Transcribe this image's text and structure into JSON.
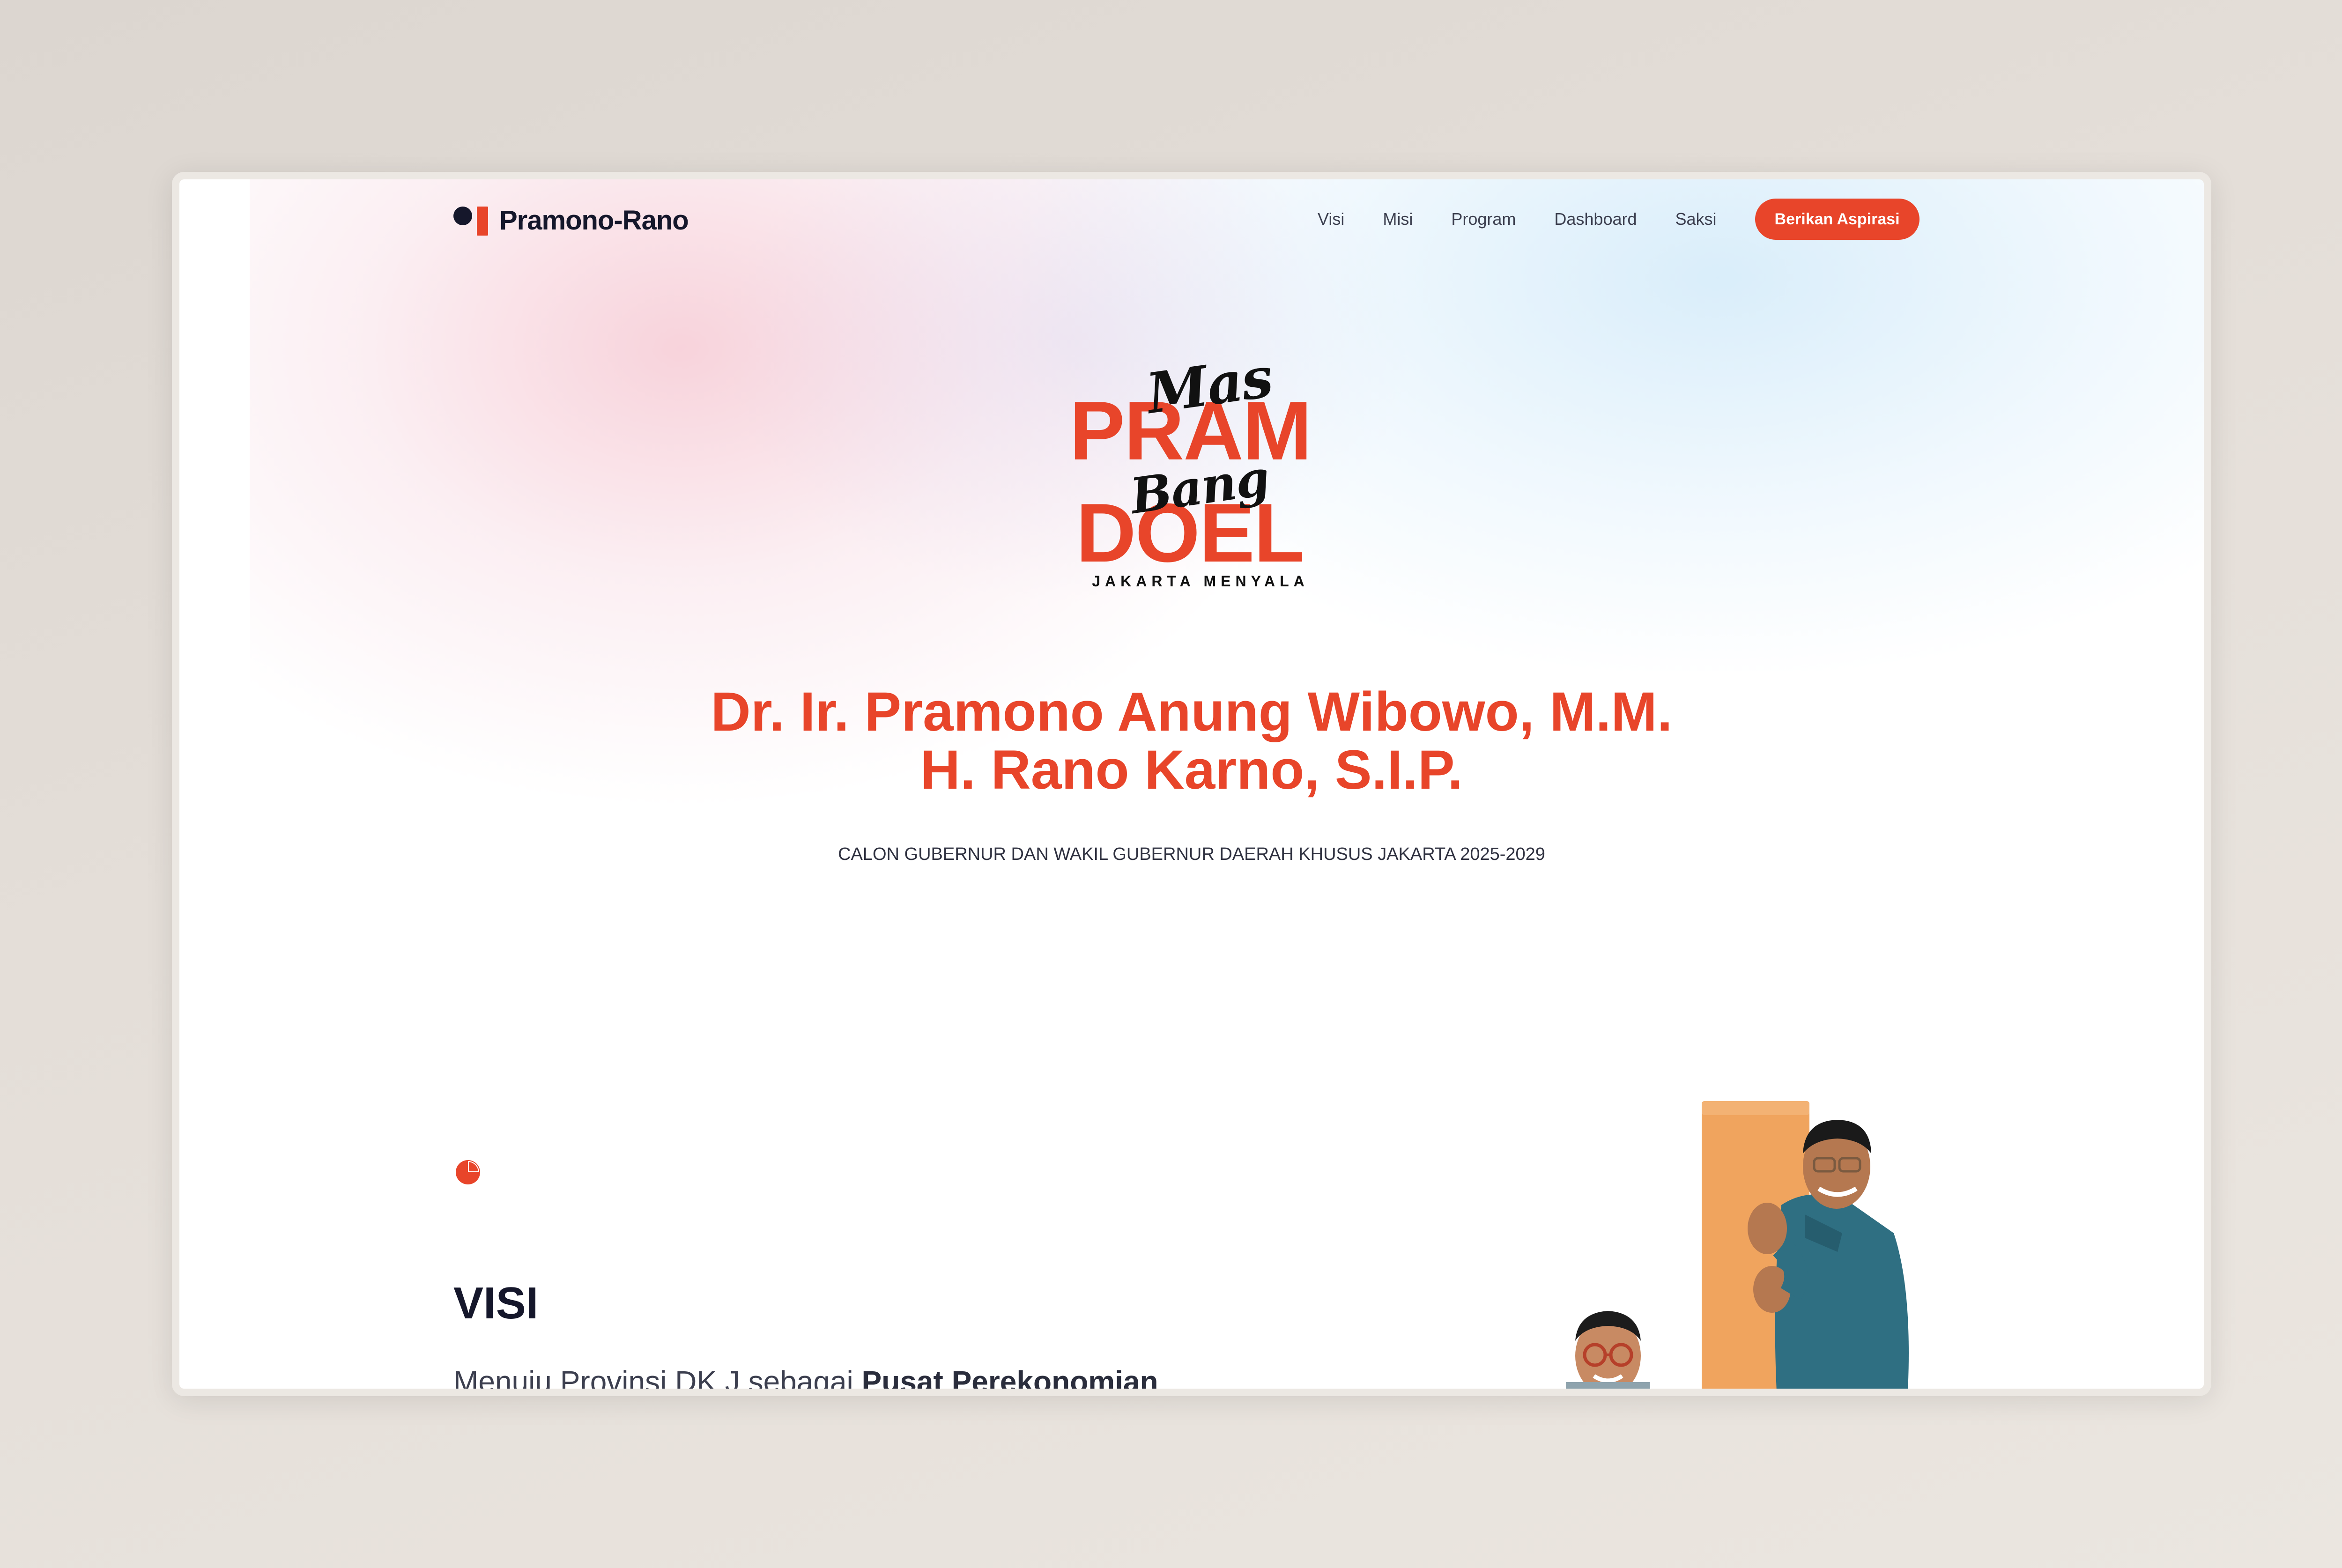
{
  "nav": {
    "brand": "Pramono-Rano",
    "links": [
      "Visi",
      "Misi",
      "Program",
      "Dashboard",
      "Saksi"
    ],
    "cta": "Berikan Aspirasi"
  },
  "hero": {
    "logo": {
      "script_top": "Mas",
      "block_top": "PRAM",
      "script_bottom": "Bang",
      "block_bottom": "DOEL",
      "tagline": "JAKARTA MENYALA"
    },
    "name_line1": "Dr. Ir. Pramono Anung Wibowo, M.M.",
    "name_line2": "H. Rano Karno, S.I.P.",
    "subtitle": "CALON GUBERNUR DAN WAKIL GUBERNUR DAERAH KHUSUS JAKARTA 2025-2029"
  },
  "visi": {
    "icon": "pie-chart-icon",
    "heading": "VISI",
    "text_plain": "Menuju Provinsi DK J sebagai ",
    "text_bold": "Pusat Perekonomian"
  },
  "colors": {
    "accent": "#e8452a",
    "dark": "#15172b",
    "orange_board": "#f0a45e",
    "shirt_teal": "#2f6f82"
  }
}
